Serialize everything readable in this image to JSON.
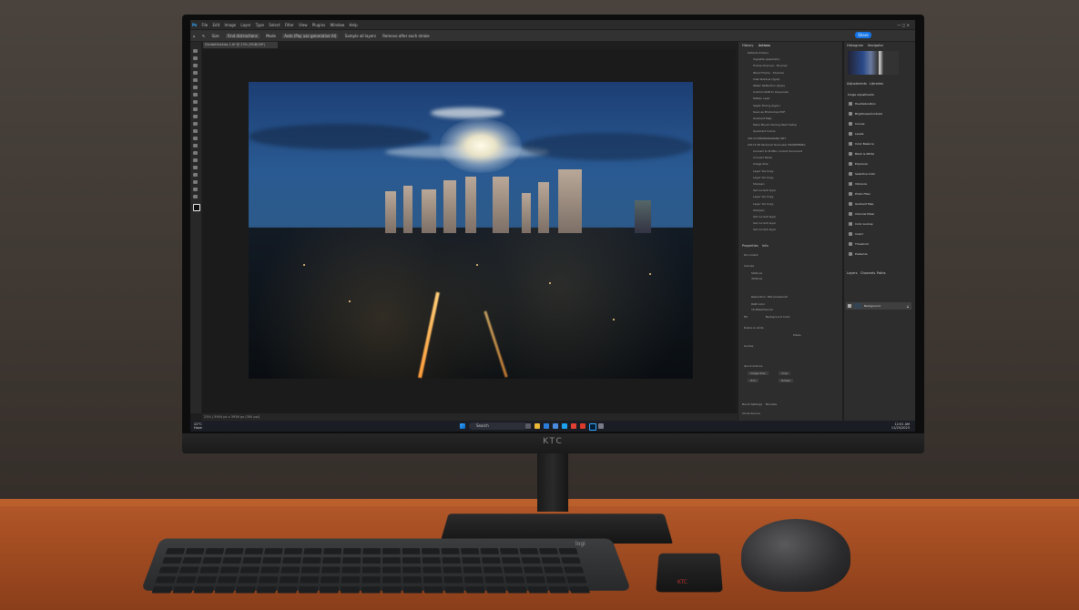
{
  "monitor": {
    "brand": "KTC"
  },
  "photoshop": {
    "menu": [
      "Ps",
      "File",
      "Edit",
      "Image",
      "Layer",
      "Type",
      "Select",
      "Filter",
      "View",
      "Plugins",
      "Window",
      "Help"
    ],
    "options": {
      "size": "Size",
      "find_distractions": "Find distractions",
      "mode_label": "Mode",
      "mode_value": "Auto (Pay use generative AI)",
      "sample_all_layers": "Sample all layers",
      "remove_after": "Remove after each stroke"
    },
    "share_label": "Share",
    "doc_tab": "DivideDickkiss-1.tif @ 23% (RGB/16*)",
    "status": "23%  |  5904 px x 3936 px (300 ppi)",
    "panels": {
      "history_tab": "History",
      "actions_tab": "Actions",
      "histogram_tab": "Histogram",
      "navigator_tab": "Navigator",
      "adjustments_tab": "Adjustments",
      "libraries_tab": "Libraries",
      "single_adjustments": "Single adjustments",
      "adjustments": [
        "Hue/Saturation",
        "Brightness/Contrast",
        "Curves",
        "Levels",
        "Color Balance",
        "Black & White",
        "Exposure",
        "Selective Color",
        "Vibrance",
        "Photo Filter",
        "Gradient Map",
        "Channel Mixer",
        "Color Lookup",
        "Invert",
        "Threshold",
        "Posterize"
      ],
      "actions": [
        "Default Actions",
        "Vignette (selection)",
        "Frame Channel - 50 pixel",
        "Wood Frame - 50 pixel",
        "Cast Shadow (type)",
        "Water Reflection (type)",
        "Custom RGB to Grayscale",
        "Molten Lead",
        "Sepia Toning (layer)",
        "Save as Photoshop PDF",
        "Gradient Map",
        "Mixer Brush Cloning Paint Setup",
        "Quadrant Colors",
        "20170 INSDRAWGRAND SET",
        "20171-TK Personal Overview SHARPENING",
        "Convert to Profile current document",
        "Convert Mode",
        "Image Size",
        "Layer Via Copy",
        "Layer Via Copy",
        "Sharpen",
        "Set current layer",
        "Layer Via Copy",
        "Layer Via Copy",
        "Sharpen",
        "Set current layer",
        "Set current layer",
        "Set current layer"
      ],
      "properties_tab": "Properties",
      "info_tab": "Info",
      "document_label": "Document",
      "canvas_label": "Canvas",
      "width": "5904 px",
      "height": "3936 px",
      "resolution": "Resolution: 300 pixels/inch",
      "mode": "RGB Color",
      "depth": "16 Bits/Channel",
      "fill": "Fill",
      "background_color": "Background Color",
      "rulers_grids": "Rulers & Grids",
      "guides": "Guides",
      "pixels": "Pixels",
      "quick_actions": "Quick Actions",
      "qa_buttons": [
        "Image Size",
        "Crop",
        "Trim",
        "Rotate"
      ],
      "brush_settings": "Brush Settings",
      "brushes": "Brushes",
      "clone_source": "Clone Source",
      "layers_tab": "Layers",
      "channels_tab": "Channels",
      "paths_tab": "Paths",
      "layer_name": "Background"
    }
  },
  "taskbar": {
    "search_label": "Search",
    "weather_temp": "22°C",
    "weather_text": "Haze",
    "time": "12:01 AM",
    "date": "11/25/2023"
  },
  "keyboard": {
    "brand": "logi"
  },
  "remote": {
    "brand": "KTC"
  }
}
